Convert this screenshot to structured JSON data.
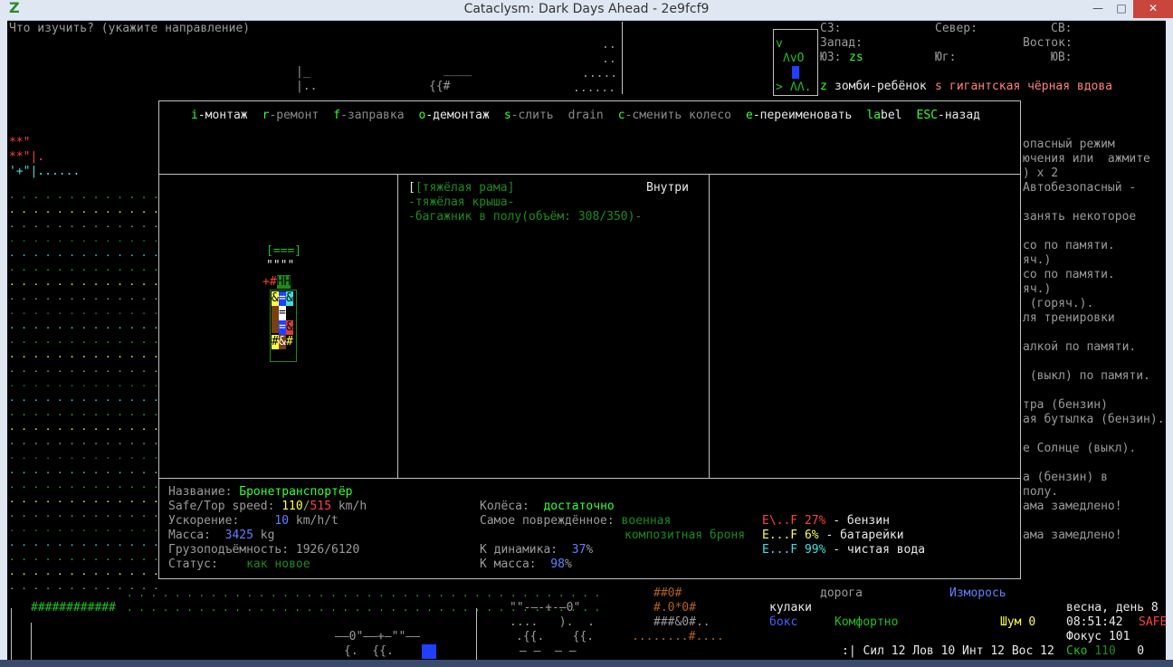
{
  "window": {
    "title": "Cataclysm: Dark Days Ahead - 2e9fcf9",
    "app_icon": "Z",
    "buttons": [
      "—",
      "□",
      "✕"
    ]
  },
  "prompt": "Что изучить? (укажите направление)",
  "compass": {
    "nw": "СЗ:",
    "n": "Север:",
    "ne": "СВ:",
    "w": "Запад:",
    "e": "Восток:",
    "sw": "ЮЗ:",
    "sw_val": "zs",
    "s": "Юг:",
    "se": "ЮВ:",
    "enemy1_glyph": "z",
    "enemy1": "зомби-ребёнок",
    "enemy2_glyph": "s",
    "enemy2": "гигантская чёрная вдова"
  },
  "menu": [
    {
      "key": "i",
      "rest": "-монтаж",
      "active": true
    },
    {
      "key": "r",
      "rest": "-ремонт",
      "active": false
    },
    {
      "key": "f",
      "rest": "-заправка",
      "active": false
    },
    {
      "key": "o",
      "rest": "-демонтаж",
      "active": true
    },
    {
      "key": "s",
      "rest": "-слить",
      "active": false
    },
    {
      "key": "",
      "rest": "drain",
      "active": false
    },
    {
      "key": "c",
      "rest": "-сменить колесо",
      "active": false
    },
    {
      "key": "e",
      "rest": "-переименовать",
      "active": true
    },
    {
      "key": "la",
      "rest": "bel",
      "active": true
    },
    {
      "key": "ESC",
      "rest": "-назад",
      "active": true
    }
  ],
  "parts": {
    "location": "Внутри",
    "list": [
      "[тяжёлая рама]",
      "-тяжёлая крыша-",
      "-багажник в полу(объём: 308/350)-"
    ]
  },
  "vehicle": {
    "name_label": "Название:",
    "name": "Бронетранспортёр",
    "speed_label": "Safe/Top speed:",
    "speed_safe": "110",
    "speed_sep": "/",
    "speed_top": "515",
    "speed_unit": "km/h",
    "accel_label": "Ускорение:",
    "accel": "10",
    "accel_unit": "km/h/t",
    "mass_label": "Масса:",
    "mass": "3425",
    "mass_unit": "kg",
    "cargo_label": "Грузоподъёмность:",
    "cargo": "1926/6120",
    "status_label": "Статус:",
    "status": "как новое",
    "wheels_label": "Колёса:",
    "wheels": "достаточно",
    "damaged_label": "Самое повреждённое:",
    "damaged1": "военная",
    "damaged2": "композитная броня",
    "dyn_label": "К динамика:",
    "dyn": "37",
    "pct": "%",
    "kmass_label": "К масса:",
    "kmass": "98",
    "fuel": [
      {
        "gauge": "E\\..F",
        "pct": "27%",
        "name": "- бензин",
        "color": "#ff4040"
      },
      {
        "gauge": "E...F",
        "pct": "6%",
        "name": "- батарейки",
        "color": "#ffff44"
      },
      {
        "gauge": "E...F",
        "pct": "99%",
        "name": "- чистая вода",
        "color": "#40e0e0"
      }
    ]
  },
  "log": [
    "опасный режим",
    "ючения или  ажмите",
    ") x 2",
    "Автобезопасный -",
    "",
    "занять некоторое",
    "",
    "со по памяти.",
    "яч.)",
    "со по памяти.",
    "яч.)",
    " (горяч.).",
    "ля тренировки",
    "",
    "алкой по памяти.",
    "",
    " (выкл) по памяти.",
    "",
    "тра (бензин)",
    "ая бутылка (бензин).",
    "",
    "е Солнце (выкл).",
    "",
    "а (бензин) в",
    "полу.",
    "ама замедлено!",
    "",
    "ама замедлено!"
  ],
  "status": {
    "terrain": "дорога",
    "weather": "Изморось",
    "weapon": "кулаки",
    "style": "бокс",
    "temp": "Комфортно",
    "noise_label": "Шум",
    "noise": "0",
    "date": "весна, день 8",
    "time": "08:51:42",
    "safe": "SAFE",
    "focus": "Фокус 101",
    "stats": ":| Сил 12 Лов 10 Инт 12 Вос 12",
    "spd_label": "Ско",
    "spd": "110",
    "spd_extra": "0"
  },
  "map_bits": {
    "top_dots1": "..",
    "top_dots2": "..",
    "top_dots3": ".....",
    "top_dots4": "......",
    "top_bar": "____",
    "top_frag": "{{#",
    "top_left1": "|_",
    "top_left2": "|..",
    "left1": "**\"",
    "left2": "**\"|.",
    "left3": "'+\"|......",
    "bottom_hash": "############",
    "bottom_nums1": "##0#",
    "bottom_nums2": "#.0*0#",
    "bottom_nums3": "###&0#..",
    "b_a": "\"\"-—-+-—0\"",
    "b_b": "....   ).  .",
    "b_c": ".{{.    {{.",
    "b_d": "........#....",
    "b_e": "——0\"——+—\"\"——",
    "b_f": "{.  {{.",
    "b_g": "— —  — —",
    "vehicle_art": [
      "[===]",
      "\"\"\"\"",
      "+#HH",
      "&=&",
      "=",
      "=",
      "=&",
      "#&#"
    ]
  }
}
